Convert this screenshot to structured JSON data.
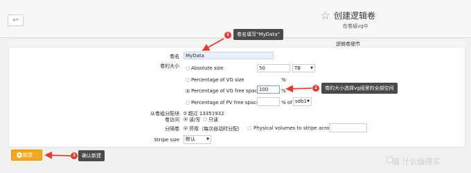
{
  "header": {
    "back_label": "↩",
    "title": "创建逻辑卷",
    "subtitle": "在卷组vg中"
  },
  "section": {
    "title": "逻辑卷细节"
  },
  "form": {
    "name_label": "卷名",
    "name_value": "MyData",
    "size_label": "卷的大小",
    "size_options": {
      "absolute": {
        "label": "Absolute size",
        "value": "50",
        "unit": "TB"
      },
      "vg_size": {
        "label": "Percentage of VG size",
        "value": "",
        "unit": "%"
      },
      "vg_free": {
        "label": "Percentage of VG free space",
        "value": "100",
        "unit": "%"
      },
      "pv_free": {
        "label": "Percentage of PV free space",
        "value": "",
        "unit": "% of",
        "device": "sdb1"
      }
    },
    "alloc_label": "从卷组分配块",
    "alloc_value": "0 超过 13351932",
    "access_label": "卷访问",
    "access_options": [
      "读/写",
      "只读"
    ],
    "stripe_label": "分隔卷",
    "stripe_options": [
      "停用（每次自动时分配）",
      "Physical volumes to stripe across"
    ],
    "stripe_size_label": "Stripe size",
    "stripe_size_value": "默认"
  },
  "actions": {
    "create_label": "新建"
  },
  "annotations": [
    {
      "number": "1",
      "text": "卷名填写“MyData”"
    },
    {
      "number": "2",
      "text": "卷的大小选择vg组里的全部空间"
    },
    {
      "number": "3",
      "text": "确认新建"
    }
  ],
  "watermark": {
    "text": "值 什么值得买"
  },
  "colors": {
    "accent": "#f5a623",
    "callout": "#4a4a4a",
    "badge": "#e8382d",
    "arrow": "#e8382d"
  }
}
